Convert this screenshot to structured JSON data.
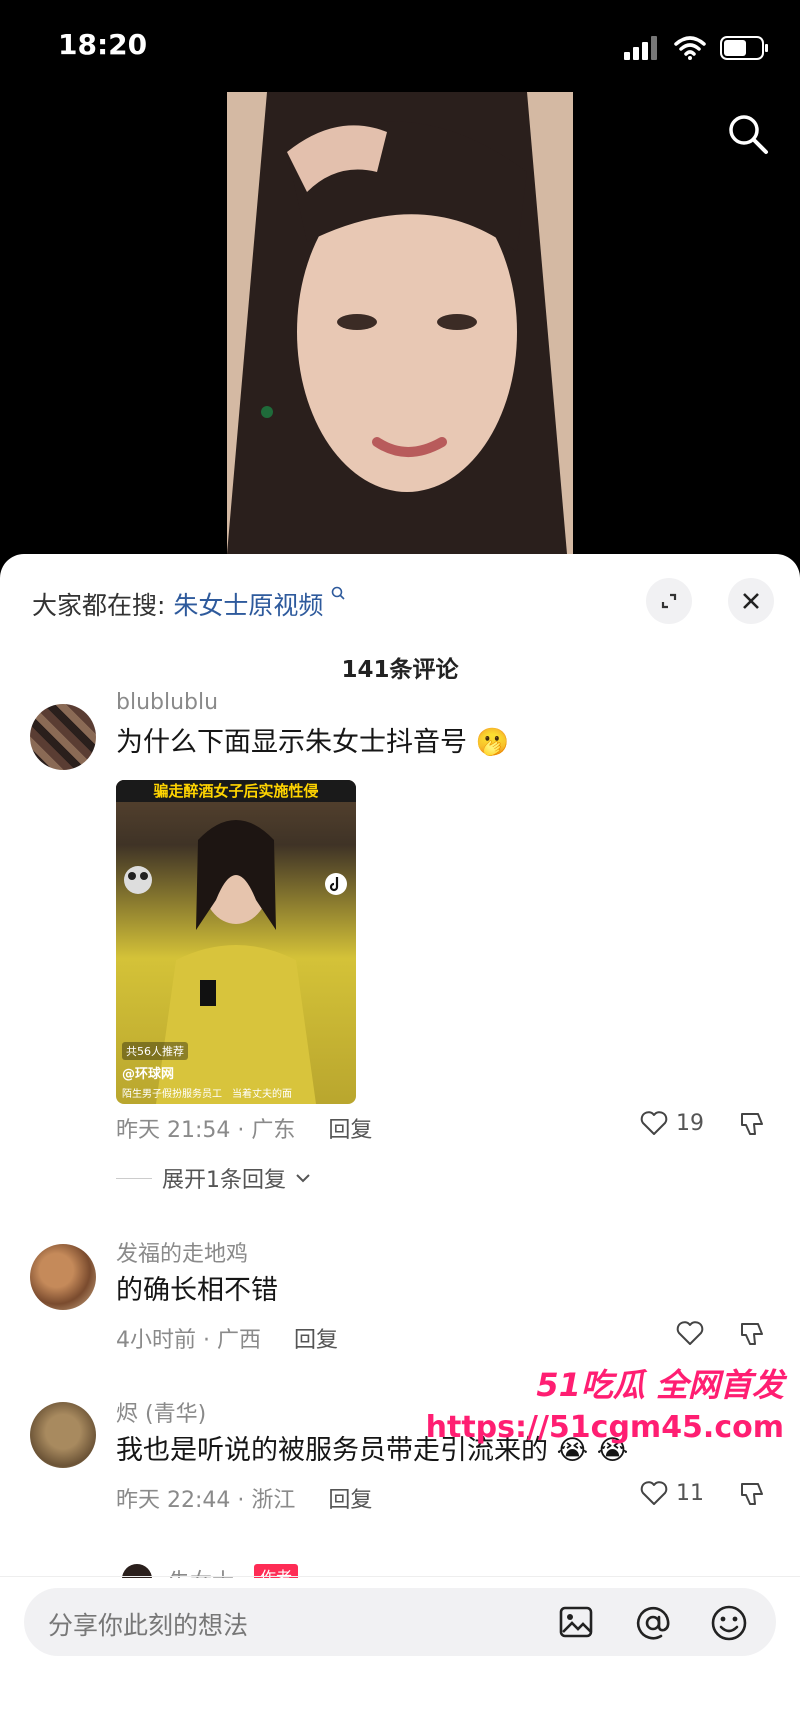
{
  "status": {
    "time": "18:20"
  },
  "panel": {
    "trending_prefix": "大家都在搜:",
    "trending_link": "朱女士原视频",
    "comment_count": "141条评论"
  },
  "comments": [
    {
      "username": "blublublu",
      "text": "为什么下面显示朱女士抖音号",
      "emoji": "🫢",
      "thumb": {
        "banner": "骗走醉酒女子后实施性侵",
        "likes": "共56人推荐",
        "source": "@环球网",
        "caption": "陌生男子假扮服务员工　当着丈夫的面"
      },
      "time_location": "昨天 21:54 · 广东",
      "reply_label": "回复",
      "likes": "19",
      "expand_label": "展开1条回复"
    },
    {
      "username": "发福的走地鸡",
      "text": "的确长相不错",
      "time_location": "4小时前 · 广西",
      "reply_label": "回复",
      "likes": ""
    },
    {
      "username": "烬 (青华)",
      "text": "我也是听说的被服务员带走引流来的",
      "emoji": "😭 😭",
      "time_location": "昨天 22:44 · 浙江",
      "reply_label": "回复",
      "likes": "11"
    }
  ],
  "partial_comment": {
    "username": "朱女士",
    "badge": "作者"
  },
  "watermark": {
    "line1": "51吃瓜 全网首发",
    "line2": "https://51cgm45.com"
  },
  "input": {
    "placeholder": "分享你此刻的想法"
  }
}
